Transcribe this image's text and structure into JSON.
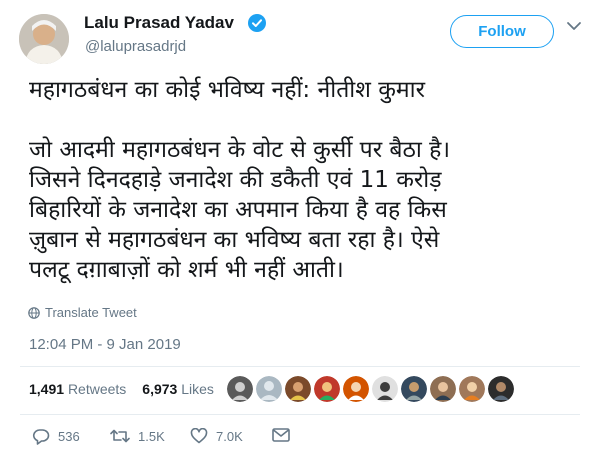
{
  "author": {
    "name": "Lalu Prasad Yadav",
    "handle": "@laluprasadrjd",
    "verified": true,
    "avatar_icon": "person-avatar"
  },
  "follow_label": "Follow",
  "tweet": {
    "headline": "महागठबंधन का कोई भविष्य नहीं: नीतीश कुमार",
    "body": "जो आदमी महागठबंधन के वोट से कुर्सी पर बैठा है।\nजिसने दिनदहाड़े जनादेश की डकैती एवं 11 करोड़\nबिहारियों के जनादेश का अपमान किया है वह किस\nज़ुबान से महागठबंधन का भविष्य बता रहा है। ऐसे\nपलटू दग़ाबाज़ों को शर्म भी नहीं आती।"
  },
  "translate_label": "Translate Tweet",
  "timestamp": "12:04 PM - 9 Jan 2019",
  "stats": {
    "retweets_count": "1,491",
    "retweets_label": "Retweets",
    "likes_count": "6,973",
    "likes_label": "Likes"
  },
  "likers_count": 10,
  "actions": {
    "replies": "536",
    "retweets": "1.5K",
    "likes": "7.0K"
  },
  "colors": {
    "accent": "#1da1f2",
    "muted": "#657786",
    "text": "#14171a",
    "divider": "#e6ecf0"
  }
}
